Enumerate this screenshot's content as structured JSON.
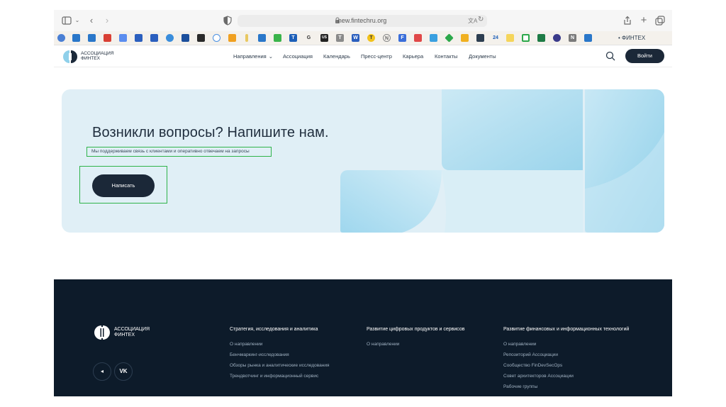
{
  "browser": {
    "url": "new.fintechru.org",
    "bookmark_fintech_label": "• ФИНТЕХ",
    "bookmark_glyphs": [
      "T",
      "G",
      "US",
      "T",
      "W",
      "T",
      "N",
      "F",
      "24",
      "N"
    ]
  },
  "header": {
    "logo_line1": "Ассоциация",
    "logo_line2": "Финтех",
    "nav": [
      "Направления",
      "Ассоциация",
      "Календарь",
      "Пресс-центр",
      "Карьера",
      "Контакты",
      "Документы"
    ],
    "login_label": "Войти"
  },
  "contact": {
    "title": "Возникли вопросы? Напишите нам.",
    "subtitle": "Мы поддерживаем связь с клиентами и  оперативно отвечаем на запросы",
    "button_label": "Написать"
  },
  "footer": {
    "logo_line1": "Ассоциация",
    "logo_line2": "Финтех",
    "social": [
      "◂",
      "VK"
    ],
    "columns": [
      {
        "title": "Стратегия, исследования и аналитика",
        "links": [
          "О направлении",
          "Бенчмаркинг-исследования",
          "Обзоры рынка и аналитические исследования",
          "Трендвотчинг и информационный сервис"
        ]
      },
      {
        "title": "Развитие цифровых продуктов и сервисов",
        "links": [
          "О направлении"
        ]
      },
      {
        "title": "Развитие финансовых и информационных технологий",
        "links": [
          "О направлении",
          "Репозиторий Ассоциации",
          "Сообщество FinDevSecOps",
          "Совет архитекторов Ассоциации",
          "Рабочие группы"
        ]
      }
    ]
  },
  "colors": {
    "dark_navy": "#1b2838",
    "footer_bg": "#0d1b2a",
    "banner_bg": "#e0eff6",
    "highlight_green": "#2fb34a",
    "accent_blue": "#8fd0ea"
  }
}
